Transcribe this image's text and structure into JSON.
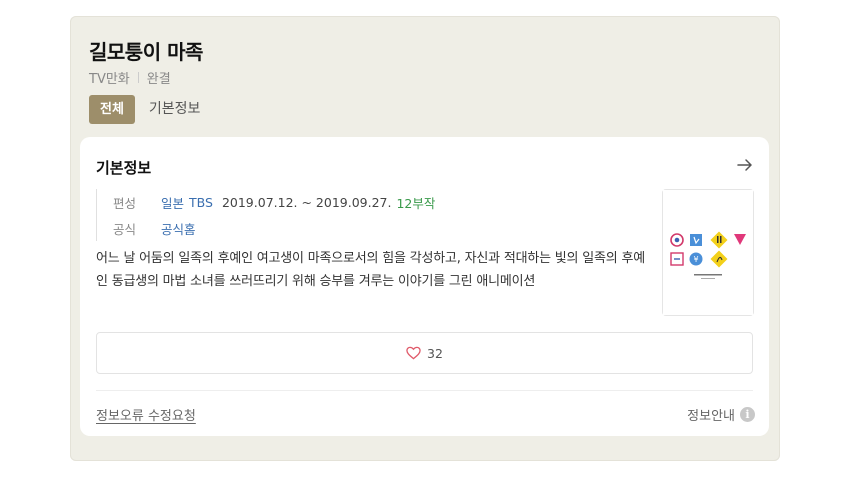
{
  "header": {
    "title": "길모퉁이 마족",
    "category": "TV만화",
    "status": "완결"
  },
  "tabs": [
    {
      "label": "전체",
      "active": true
    },
    {
      "label": "기본정보",
      "active": false
    }
  ],
  "basic_info": {
    "title": "기본정보",
    "broadcast_label": "편성",
    "country": "일본",
    "channel": "TBS",
    "period": "2019.07.12. ~ 2019.09.27.",
    "episodes": "12부작",
    "official_label": "공식",
    "official_link": "공식홈",
    "description": "어느 날 어둠의 일족의 후예인 여고생이 마족으로서의 힘을 각성하고, 자신과 적대하는 빛의 일족의 후예인 동급생의 마법 소녀를 쓰러뜨리기 위해 승부를 겨루는 이야기를 그린 애니메이션",
    "like_count": "32"
  },
  "footer": {
    "report_link": "정보오류 수정요청",
    "info_guide": "정보안내"
  },
  "colors": {
    "active_tab": "#9d8e6a",
    "link": "#3b6fb0",
    "episodes": "#3a9a4b",
    "heart": "#e05a6a",
    "background_panel": "#efeee6"
  },
  "icons": {
    "arrow": "arrow-right-icon",
    "heart": "heart-icon",
    "info": "info-icon"
  }
}
